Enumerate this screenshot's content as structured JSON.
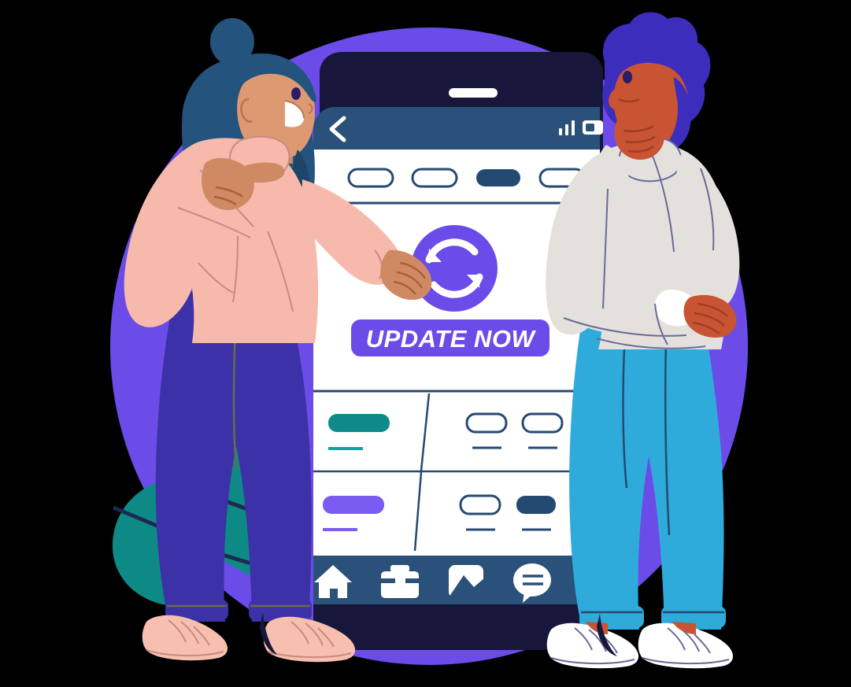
{
  "illustration": {
    "title": "App Update Illustration",
    "description": "Two people standing beside a large smartphone showing an app update screen"
  },
  "palette": {
    "background": "#000000",
    "circle_purple": "#6c4ce8",
    "phone_frame_dark": "#16173a",
    "phone_header_blue": "#2a5179",
    "phone_screen_white": "#ffffff",
    "accent_purple": "#6c4ce8",
    "accent_teal": "#0f8a8a",
    "navy": "#254a72",
    "leaf_teal": "#0e8a86",
    "woman_hair": "#24537d",
    "woman_skin": "#dd9a72",
    "woman_sweater": "#f7b9ac",
    "woman_pants": "#3d31a8",
    "woman_shoes": "#f7bfae",
    "man_hair": "#3c2dbd",
    "man_skin": "#c85433",
    "man_sweater": "#e4e0dc",
    "man_pants": "#2eabdb",
    "man_shoes": "#ffffff"
  },
  "phone": {
    "speaker_slot": "speaker-slot",
    "status_bar": {
      "back_icon": "chevron-left-icon",
      "signal_icon": "signal-bars-icon",
      "battery_icon": "battery-icon"
    },
    "tabs": [
      {
        "name": "tab-1",
        "label": "",
        "active": false
      },
      {
        "name": "tab-2",
        "label": "",
        "active": false
      },
      {
        "name": "tab-3",
        "label": "",
        "active": true
      },
      {
        "name": "tab-4",
        "label": "",
        "active": false
      }
    ],
    "update_card": {
      "refresh_icon": "refresh-circular-arrows-icon",
      "button_label": "UPDATE NOW",
      "button_color": "#6c4ce8"
    },
    "list_rows": [
      {
        "name": "list-row-1",
        "left_pill_color": "#0f8a8a",
        "left_underline_color": "#16a3a0",
        "right_pills": [
          "outline",
          "outline"
        ]
      },
      {
        "name": "list-row-2",
        "left_pill_color": "#7a5cf0",
        "left_underline_color": "#7a5cf0",
        "right_pills": [
          "outline",
          "filled"
        ]
      }
    ],
    "bottom_nav": [
      {
        "name": "nav-home",
        "icon": "home-icon"
      },
      {
        "name": "nav-briefcase",
        "icon": "briefcase-icon"
      },
      {
        "name": "nav-chart",
        "icon": "chart-image-icon"
      },
      {
        "name": "nav-chat",
        "icon": "chat-bubble-icon"
      }
    ]
  },
  "characters": [
    {
      "name": "woman-pointing",
      "pose": "pointing at phone",
      "hair_color": "#24537d",
      "top_color": "#f7b9ac",
      "pants_color": "#3d31a8",
      "shoe_color": "#f7bfae"
    },
    {
      "name": "man-arms-crossed",
      "pose": "arms crossed looking at phone",
      "hair_color": "#3c2dbd",
      "top_color": "#e4e0dc",
      "pants_color": "#2eabdb",
      "shoe_color": "#ffffff"
    }
  ]
}
